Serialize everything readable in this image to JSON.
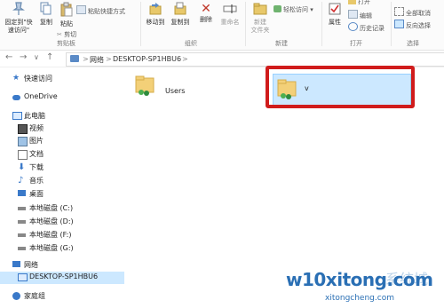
{
  "ribbon": {
    "pin_label": "固定到\"快\n速访问\"",
    "copy_label": "复制",
    "paste_label": "粘贴",
    "paste_shortcut_label": "粘贴快捷方式",
    "cut_label": "剪切",
    "clipboard_group": "剪贴板",
    "move_label": "移动到",
    "copyto_label": "复制到",
    "delete_label": "删除",
    "rename_label": "重命名",
    "organize_group": "组织",
    "newfolder_label": "新建\n文件夹",
    "easyaccess_label": "轻松访问 ▾",
    "new_group": "新建",
    "properties_label": "属性",
    "open_label": "打开",
    "edit_label": "编辑",
    "history_label": "历史记录",
    "open_group": "打开",
    "selectall_label": "全部取消",
    "invert_label": "反向选择",
    "select_group": "选择"
  },
  "address": {
    "back": "←",
    "forward": "→",
    "dropdown": "∨",
    "up": "↑",
    "crumbs": [
      "网络",
      "DESKTOP-SP1HBU6"
    ],
    "sep": ">"
  },
  "nav": {
    "items": [
      {
        "label": "快速访问",
        "icon": "star-icon"
      },
      {
        "label": "OneDrive",
        "icon": "cloud-icon"
      },
      {
        "label": "此电脑",
        "icon": "computer-icon"
      },
      {
        "label": "视频",
        "icon": "video-icon"
      },
      {
        "label": "图片",
        "icon": "picture-icon"
      },
      {
        "label": "文档",
        "icon": "document-icon"
      },
      {
        "label": "下载",
        "icon": "download-icon"
      },
      {
        "label": "音乐",
        "icon": "music-icon"
      },
      {
        "label": "桌面",
        "icon": "desktop-icon"
      },
      {
        "label": "本地磁盘 (C:)",
        "icon": "drive-icon"
      },
      {
        "label": "本地磁盘 (D:)",
        "icon": "drive-icon"
      },
      {
        "label": "本地磁盘 (F:)",
        "icon": "drive-icon"
      },
      {
        "label": "本地磁盘 (G:)",
        "icon": "drive-icon"
      },
      {
        "label": "网络",
        "icon": "network-icon"
      },
      {
        "label": "DESKTOP-SP1HBU6",
        "icon": "computer-icon"
      },
      {
        "label": "家庭组",
        "icon": "homegroup-icon"
      }
    ]
  },
  "content": {
    "folders": [
      {
        "name": "Users"
      },
      {
        "name": "v"
      }
    ]
  },
  "watermark": {
    "main": "w10xitong.com",
    "sub": "xitongcheng.com",
    "cn": "系统城"
  },
  "colors": {
    "selection": "#cce8ff",
    "highlight_frame": "#d01c1c",
    "watermark": "#2a6fb4"
  }
}
